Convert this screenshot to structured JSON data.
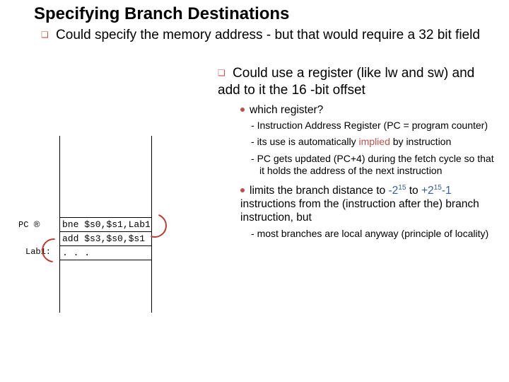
{
  "title": "Specifying Branch Destinations",
  "bullet1": "Could specify the memory address - but that would require a 32 bit field",
  "bullet2": "Could use a register (like lw and sw) and add to it the 16 -bit offset",
  "sub1": {
    "head": "which register?",
    "d1a": "Instruction Address Register (",
    "d1b": "PC",
    "d1c": " = program counter)",
    "d2a": "its use is automatically ",
    "d2b": "implied",
    "d2c": " by instruction",
    "d3": "PC gets updated (PC+4) during the fetch cycle so that it holds the address of the next instruction"
  },
  "sub2": {
    "h1": "limits the branch distance to ",
    "r1": "-2",
    "r1sup": "15",
    "h2": " to ",
    "r2": "+2",
    "r2sup": "15",
    "r2b": "-1",
    "h3": " instructions from the (instruction after the) branch instruction, but",
    "d1": "most branches are local anyway (principle of locality)"
  },
  "diag": {
    "pc": "PC",
    "arrow": "®",
    "i1": "bne  $s0,$s1,Lab1",
    "i2": "add $s3,$s0,$s1",
    "lab1": "Lab1:",
    "i3": ". . ."
  }
}
